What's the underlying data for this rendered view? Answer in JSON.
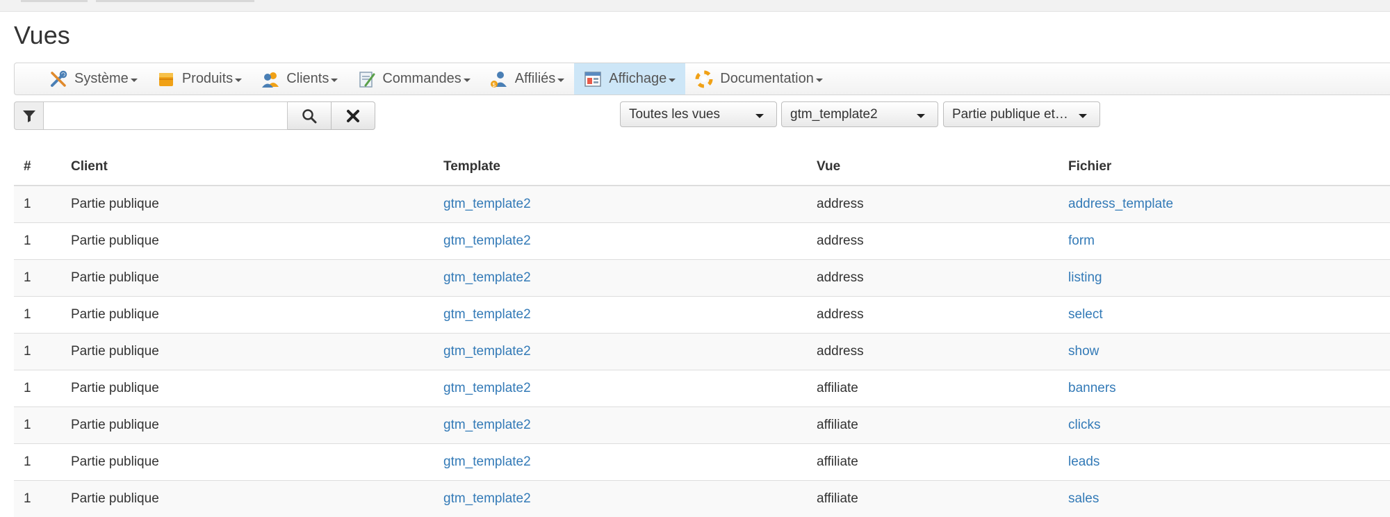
{
  "page": {
    "title": "Vues"
  },
  "menu": {
    "items": [
      {
        "label": "Système",
        "icon": "tools-icon",
        "active": false
      },
      {
        "label": "Produits",
        "icon": "box-icon",
        "active": false
      },
      {
        "label": "Clients",
        "icon": "users-icon",
        "active": false
      },
      {
        "label": "Commandes",
        "icon": "order-icon",
        "active": false
      },
      {
        "label": "Affiliés",
        "icon": "affiliate-icon",
        "active": false
      },
      {
        "label": "Affichage",
        "icon": "display-icon",
        "active": true
      },
      {
        "label": "Documentation",
        "icon": "lifebuoy-icon",
        "active": false
      }
    ]
  },
  "search": {
    "value": "",
    "placeholder": ""
  },
  "filters": {
    "views": "Toutes les vues",
    "template": "gtm_template2",
    "client": "Partie publique et…"
  },
  "table": {
    "headers": {
      "num": "#",
      "client": "Client",
      "template": "Template",
      "vue": "Vue",
      "fichier": "Fichier"
    },
    "rows": [
      {
        "num": "1",
        "client": "Partie publique",
        "template": "gtm_template2",
        "vue": "address",
        "fichier": "address_template"
      },
      {
        "num": "1",
        "client": "Partie publique",
        "template": "gtm_template2",
        "vue": "address",
        "fichier": "form"
      },
      {
        "num": "1",
        "client": "Partie publique",
        "template": "gtm_template2",
        "vue": "address",
        "fichier": "listing"
      },
      {
        "num": "1",
        "client": "Partie publique",
        "template": "gtm_template2",
        "vue": "address",
        "fichier": "select"
      },
      {
        "num": "1",
        "client": "Partie publique",
        "template": "gtm_template2",
        "vue": "address",
        "fichier": "show"
      },
      {
        "num": "1",
        "client": "Partie publique",
        "template": "gtm_template2",
        "vue": "affiliate",
        "fichier": "banners"
      },
      {
        "num": "1",
        "client": "Partie publique",
        "template": "gtm_template2",
        "vue": "affiliate",
        "fichier": "clicks"
      },
      {
        "num": "1",
        "client": "Partie publique",
        "template": "gtm_template2",
        "vue": "affiliate",
        "fichier": "leads"
      },
      {
        "num": "1",
        "client": "Partie publique",
        "template": "gtm_template2",
        "vue": "affiliate",
        "fichier": "sales"
      }
    ]
  },
  "colors": {
    "link": "#337ab7",
    "active_menu": "#cde6f7"
  }
}
